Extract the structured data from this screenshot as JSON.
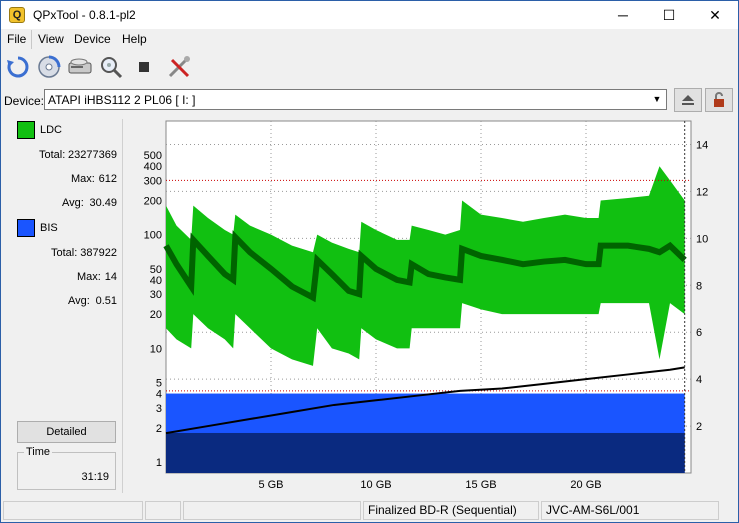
{
  "window": {
    "title": "QPxTool - 0.8.1-pl2",
    "icon_letter": "Q",
    "minimize": "─",
    "maximize": "☐",
    "close": "✕"
  },
  "menu": {
    "items": [
      "File",
      "View",
      "Device",
      "Help"
    ]
  },
  "toolbar": {
    "icons": [
      "refresh-icon",
      "disc-scan-icon",
      "drive-icon",
      "search-disc-icon",
      "stop-icon",
      "tools-icon"
    ]
  },
  "device": {
    "label": "Device:",
    "value": "ATAPI   iHBS112   2     PL06 [ I: ]",
    "eject_icon": "eject-icon",
    "lock_icon": "lock-icon"
  },
  "stats": {
    "ldc": {
      "name": "LDC",
      "color": "#11c011",
      "total_label": "Total:",
      "total": "23277369",
      "max_label": "Max:",
      "max": "612",
      "avg_label": "Avg:",
      "avg": "30.49"
    },
    "bis": {
      "name": "BIS",
      "color": "#1a55ff",
      "total_label": "Total:",
      "total": "387922",
      "max_label": "Max:",
      "max": "14",
      "avg_label": "Avg:",
      "avg": "0.51"
    }
  },
  "detailed_button": "Detailed",
  "time": {
    "label": "Time",
    "value": "31:19"
  },
  "status": {
    "cell1": "",
    "cell2": "",
    "cell3": "",
    "media": "Finalized BD-R (Sequential)",
    "media_id": "JVC-AM-S6L/001"
  },
  "chart_data": {
    "type": "area",
    "x_ticks": [
      "5 GB",
      "10 GB",
      "15 GB",
      "20 GB"
    ],
    "x_tick_values": [
      5,
      10,
      15,
      20
    ],
    "xlim": [
      0,
      25
    ],
    "y_left_ticks": [
      "1",
      "2",
      "3",
      "4",
      "5",
      "10",
      "20",
      "30",
      "40",
      "50",
      "100",
      "200",
      "300",
      "400",
      "500"
    ],
    "y_left_tick_values": [
      1,
      2,
      3,
      4,
      5,
      10,
      20,
      30,
      40,
      50,
      100,
      200,
      300,
      400,
      500
    ],
    "y_left_scale": "log",
    "ylim_left": [
      0.8,
      1000
    ],
    "y_right_ticks": [
      "2",
      "4",
      "6",
      "8",
      "10",
      "12",
      "14"
    ],
    "y_right_tick_values": [
      2,
      4,
      6,
      8,
      10,
      12,
      14
    ],
    "ylim_right": [
      0,
      15
    ],
    "grid": true,
    "threshold_lines": [
      300,
      3.5
    ],
    "series": [
      {
        "name": "LDC",
        "color": "#11c011",
        "dark_color": "#006400",
        "x": [
          0,
          0.5,
          1.2,
          1.3,
          2.0,
          2.8,
          3.2,
          3.3,
          4.0,
          5.0,
          6.0,
          7.0,
          7.2,
          7.9,
          8.7,
          9.2,
          9.3,
          10.0,
          11.0,
          11.6,
          11.7,
          12.5,
          13.3,
          14.0,
          14.1,
          15.0,
          16.0,
          17.0,
          18.0,
          19.0,
          20.0,
          20.6,
          20.7,
          22.0,
          23.0,
          23.5,
          24.0,
          24.7
        ],
        "avg": [
          80,
          55,
          35,
          90,
          65,
          45,
          40,
          95,
          70,
          50,
          35,
          28,
          60,
          45,
          32,
          30,
          65,
          50,
          40,
          38,
          55,
          45,
          42,
          40,
          75,
          65,
          60,
          55,
          58,
          60,
          55,
          55,
          80,
          80,
          75,
          70,
          80,
          60
        ],
        "max": [
          180,
          120,
          90,
          180,
          140,
          110,
          100,
          150,
          120,
          100,
          80,
          70,
          100,
          85,
          75,
          70,
          130,
          110,
          90,
          90,
          120,
          110,
          100,
          110,
          200,
          150,
          140,
          130,
          140,
          150,
          140,
          140,
          200,
          210,
          220,
          400,
          300,
          200
        ],
        "min": [
          15,
          12,
          10,
          20,
          15,
          12,
          10,
          20,
          15,
          10,
          8,
          7,
          15,
          10,
          9,
          8,
          15,
          12,
          10,
          10,
          15,
          15,
          15,
          15,
          25,
          22,
          20,
          20,
          20,
          20,
          20,
          20,
          25,
          25,
          25,
          8,
          25,
          20
        ]
      },
      {
        "name": "BIS",
        "color": "#1a55ff",
        "dark_color": "#0a2a80",
        "x": [
          0,
          25
        ],
        "level": [
          4,
          4
        ],
        "dark_level": [
          1.8,
          1.8
        ]
      },
      {
        "name": "Speed",
        "color": "#000000",
        "axis": "right",
        "x": [
          0,
          2,
          4,
          6,
          8,
          10,
          12,
          14,
          16,
          18,
          20,
          22,
          24,
          24.7
        ],
        "y": [
          1.7,
          2.0,
          2.3,
          2.6,
          2.9,
          3.1,
          3.3,
          3.5,
          3.6,
          3.8,
          4.0,
          4.2,
          4.4,
          4.5
        ]
      }
    ]
  }
}
